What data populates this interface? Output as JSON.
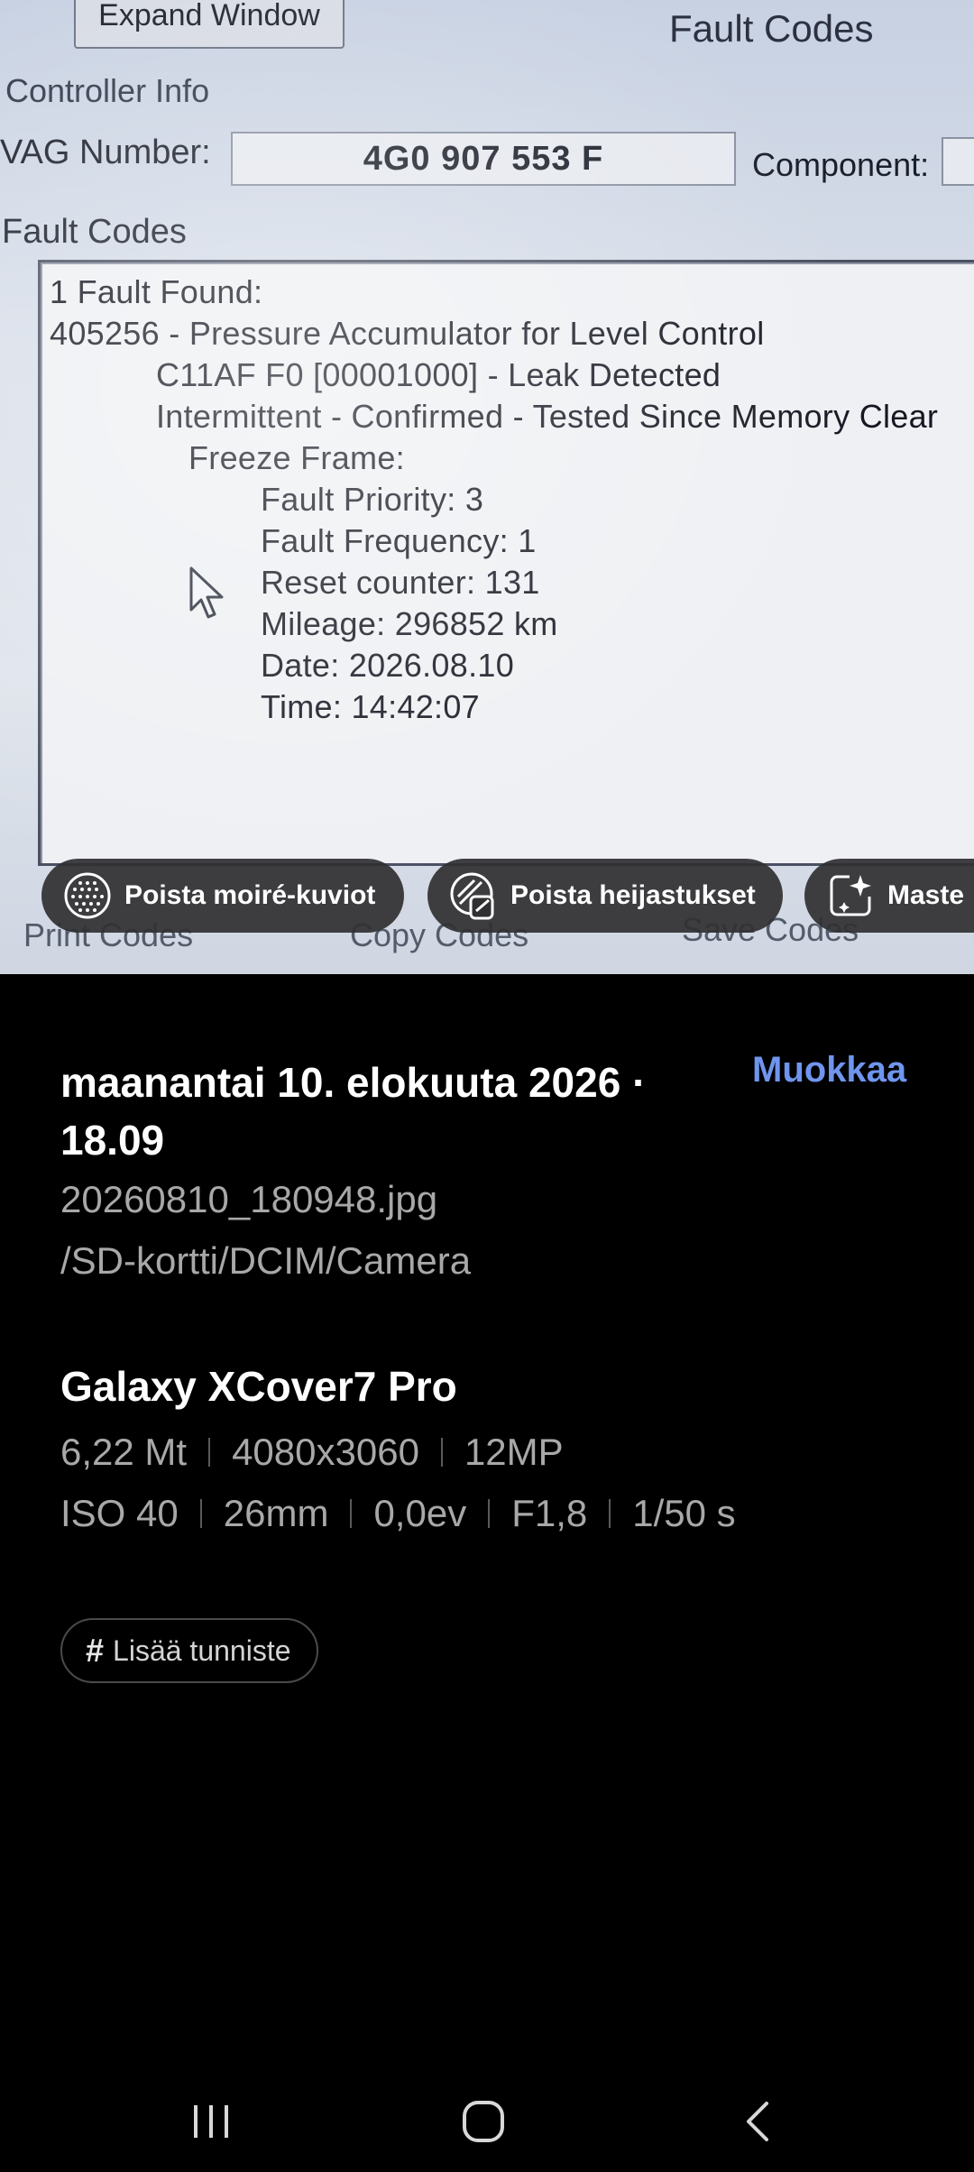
{
  "photo": {
    "expand_window": "Expand Window",
    "fault_codes_title": "Fault Codes",
    "controller_info": "Controller Info",
    "vag_number_label": "VAG Number:",
    "vag_number_value": "4G0 907 553 F",
    "component_label": "Component:",
    "fault_codes_label": "Fault Codes",
    "fault_lines": [
      "1 Fault Found:",
      "405256 - Pressure Accumulator for Level Control",
      "C11AF F0 [00001000] - Leak Detected",
      "Intermittent - Confirmed - Tested Since Memory Clear",
      "Freeze Frame:",
      "Fault Priority: 3",
      "Fault Frequency: 1",
      "Reset counter: 131",
      "Mileage: 296852 km",
      "Date: 2026.08.10",
      "Time: 14:42:07"
    ],
    "bottom_buttons": [
      "Print Codes",
      "Copy Codes",
      "Save Codes"
    ]
  },
  "chips": [
    {
      "label": "Poista moiré-kuviot",
      "icon": "moire-icon"
    },
    {
      "label": "Poista heijastukset",
      "icon": "reflection-icon"
    },
    {
      "label": "Maste",
      "icon": "ai-edit-icon"
    }
  ],
  "info": {
    "date": "maanantai 10. elokuuta 2026 · 18.09",
    "edit": "Muokkaa",
    "file_name": "20260810_180948.jpg",
    "file_path": "/SD-kortti/DCIM/Camera",
    "device": "Galaxy XCover7 Pro",
    "specs_row1": [
      "6,22 Mt",
      "4080x3060",
      "12MP"
    ],
    "specs_row2": [
      "ISO 40",
      "26mm",
      "0,0ev",
      "F1,8",
      "1/50 s"
    ],
    "add_tag": "Lisää tunniste"
  },
  "nav": {
    "icons": [
      "recents-icon",
      "home-icon",
      "back-icon"
    ]
  },
  "colors": {
    "accent": "#6f95ee",
    "background": "#000000",
    "chip_bg": "#303032"
  }
}
